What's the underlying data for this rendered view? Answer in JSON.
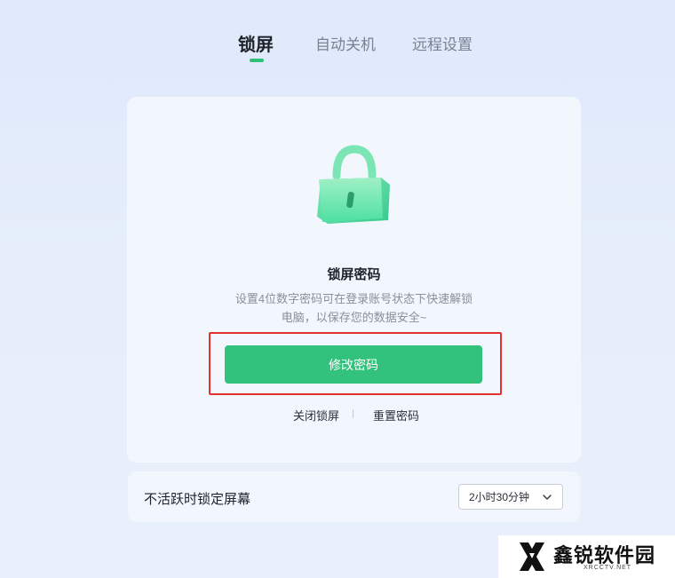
{
  "tabs": [
    {
      "label": "锁屏",
      "active": true
    },
    {
      "label": "自动关机",
      "active": false
    },
    {
      "label": "远程设置",
      "active": false
    }
  ],
  "lock_card": {
    "icon": "lock-icon",
    "title": "锁屏密码",
    "description_line1": "设置4位数字密码可在登录账号状态下快速解锁",
    "description_line2": "电脑，以保存您的数据安全~",
    "primary_button": "修改密码",
    "link_close": "关闭锁屏",
    "link_reset": "重置密码"
  },
  "auto_lock": {
    "label": "不活跃时锁定屏幕",
    "selected_value": "2小时30分钟",
    "icon": "chevron-down-icon"
  },
  "watermark": {
    "name": "鑫锐软件园",
    "sub": "XRCCTV.NET"
  },
  "colors": {
    "accent": "#33c27c",
    "highlight": "#e53030"
  }
}
